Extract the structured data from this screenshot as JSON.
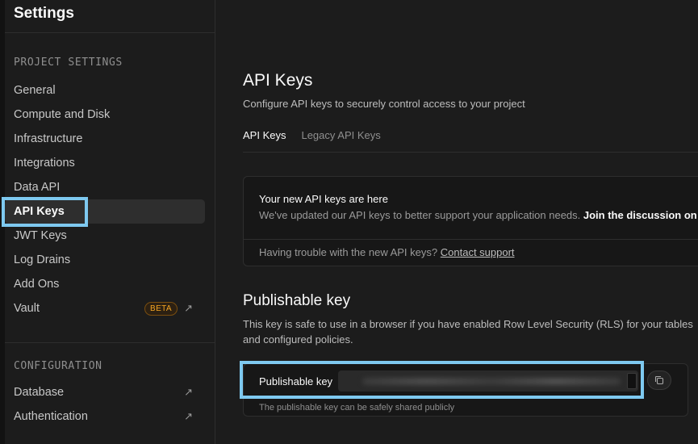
{
  "sidebar": {
    "title": "Settings",
    "project_section": "PROJECT SETTINGS",
    "items": [
      {
        "label": "General"
      },
      {
        "label": "Compute and Disk"
      },
      {
        "label": "Infrastructure"
      },
      {
        "label": "Integrations"
      },
      {
        "label": "Data API"
      },
      {
        "label": "API Keys"
      },
      {
        "label": "JWT Keys"
      },
      {
        "label": "Log Drains"
      },
      {
        "label": "Add Ons"
      },
      {
        "label": "Vault",
        "badge": "BETA"
      }
    ],
    "config_section": "CONFIGURATION",
    "config_items": [
      {
        "label": "Database"
      },
      {
        "label": "Authentication"
      }
    ],
    "external_glyph": "↗"
  },
  "main": {
    "title": "API Keys",
    "subtitle": "Configure API keys to securely control access to your project",
    "tabs": [
      {
        "label": "API Keys"
      },
      {
        "label": "Legacy API Keys"
      }
    ],
    "notice": {
      "title": "Your new API keys are here",
      "body": "We've updated our API keys to better support your application needs.",
      "link": "Join the discussion on",
      "footer": "Having trouble with the new API keys?",
      "footer_link": "Contact support"
    },
    "publishable": {
      "title": "Publishable key",
      "description": "This key is safe to use in a browser if you have enabled Row Level Security (RLS) for your tables and configured policies.",
      "label": "Publishable key",
      "note": "The publishable key can be safely shared publicly"
    }
  },
  "colors": {
    "highlight": "#7ec9f0",
    "accent_badge": "#f5a623",
    "background": "#1c1c1c"
  }
}
